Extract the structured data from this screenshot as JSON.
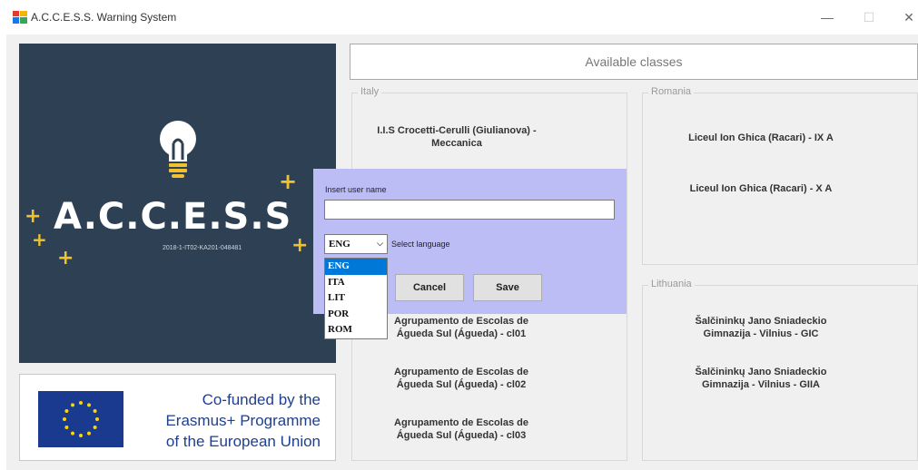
{
  "window": {
    "title": "A.C.C.E.S.S. Warning System",
    "controls": {
      "minimize": "—",
      "maximize": "☐",
      "close": "✕"
    }
  },
  "logo": {
    "brand": "A.C.C.E.S.S",
    "code": "2018-1-IT02-KA201-048481",
    "accent_color": "#f2c12e"
  },
  "eu": {
    "line1": "Co-funded by the",
    "line2": "Erasmus+ Programme",
    "line3": "of the European Union"
  },
  "available_button": "Available classes",
  "groups": {
    "italy": {
      "legend": "Italy",
      "items": [
        "I.I.S Crocetti-Cerulli (Giulianova) -",
        "Meccanica"
      ]
    },
    "romania": {
      "legend": "Romania",
      "items": [
        "Liceul Ion Ghica (Racari) - IX A",
        "Liceul Ion Ghica (Racari) - X A"
      ]
    },
    "portugal": {
      "items": [
        [
          "Agrupamento de Escolas de",
          "Águeda Sul (Águeda) - cl01"
        ],
        [
          "Agrupamento de Escolas de",
          "Águeda Sul (Águeda) - cl02"
        ],
        [
          "Agrupamento de Escolas de",
          "Águeda Sul (Águeda) - cl03"
        ]
      ]
    },
    "lithuania": {
      "legend": "Lithuania",
      "items": [
        [
          "Šalčininkų Jano Sniadeckio",
          "Gimnazija - Vilnius - GIC"
        ],
        [
          "Šalčininkų Jano Sniadeckio",
          "Gimnazija - Vilnius - GIIA"
        ]
      ]
    }
  },
  "login": {
    "user_label": "Insert user name",
    "user_value": "",
    "language_value": "ENG",
    "language_label": "Select language",
    "cancel": "Cancel",
    "save": "Save",
    "options": [
      "ENG",
      "ITA",
      "LIT",
      "POR",
      "ROM"
    ],
    "panel_color": "#bdbdf6"
  }
}
